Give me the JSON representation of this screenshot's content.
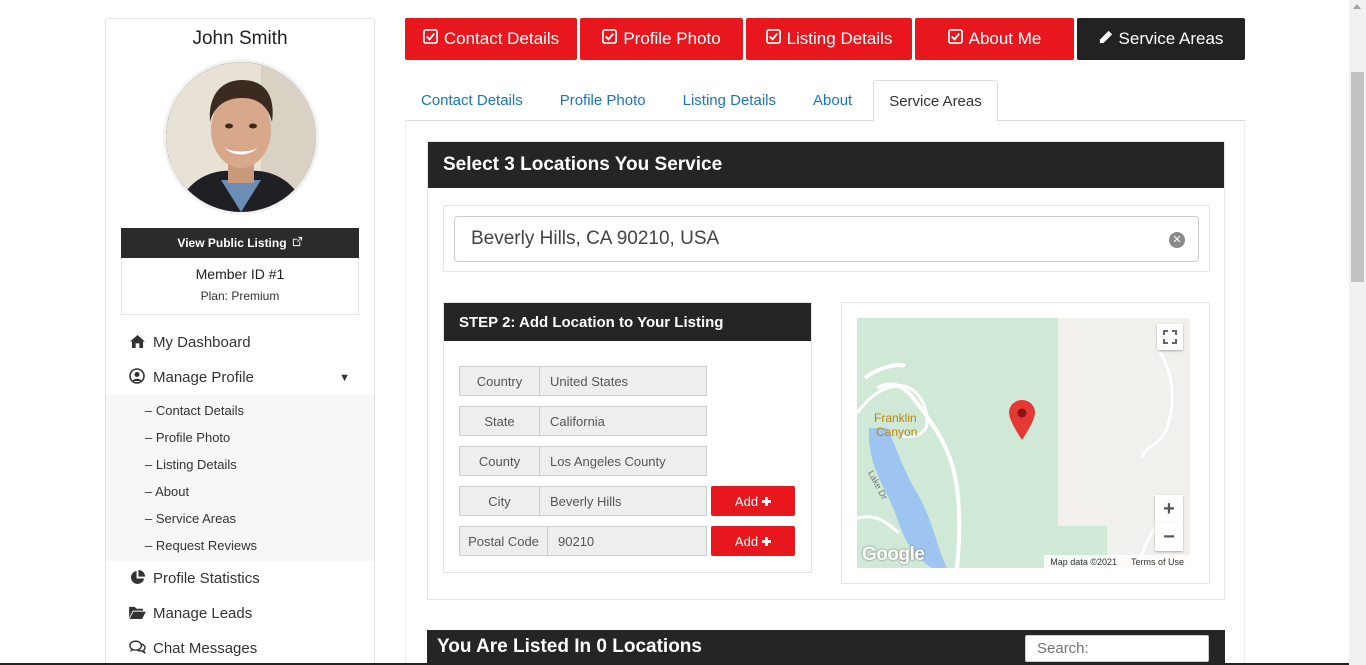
{
  "sidebar": {
    "user_name": "John Smith",
    "view_listing_label": "View Public Listing",
    "member_id": "Member ID #1",
    "plan": "Plan: Premium",
    "nav": {
      "dashboard": "My Dashboard",
      "manage_profile": "Manage Profile",
      "sub_items": [
        "– Contact Details",
        "– Profile Photo",
        "– Listing Details",
        "– About",
        "– Service Areas",
        "– Request Reviews"
      ],
      "statistics": "Profile Statistics",
      "leads": "Manage Leads",
      "chat": "Chat Messages"
    }
  },
  "top_buttons": {
    "contact": "Contact Details",
    "photo": "Profile Photo",
    "listing": "Listing Details",
    "about": "About Me",
    "service": "Service Areas"
  },
  "tabs": {
    "contact": "Contact Details",
    "photo": "Profile Photo",
    "listing": "Listing Details",
    "about": "About",
    "service": "Service Areas"
  },
  "locations_panel": {
    "title": "Select 3 Locations You Service",
    "search_value": "Beverly Hills, CA 90210, USA"
  },
  "step2": {
    "title": "STEP 2: Add Location to Your Listing",
    "fields": {
      "country_label": "Country",
      "country_value": "United States",
      "state_label": "State",
      "state_value": "California",
      "county_label": "County",
      "county_value": "Los Angeles County",
      "city_label": "City",
      "city_value": "Beverly Hills",
      "postal_label": "Postal Code",
      "postal_value": "90210"
    },
    "add_label": "Add"
  },
  "map": {
    "place_label_1": "Franklin",
    "place_label_2": "Canyon",
    "road_label": "Lake Dr",
    "logo": "Google",
    "attribution": "Map data ©2021",
    "terms": "Terms of Use",
    "zoom_in": "+",
    "zoom_out": "−",
    "fullscreen_icon": "fullscreen-icon",
    "marker_color": "#e53935"
  },
  "listed_panel": {
    "title": "You Are Listed In 0 Locations",
    "search_placeholder": "Search:"
  },
  "colors": {
    "accent": "#e8161d",
    "dark": "#222222",
    "link": "#1a73c9"
  }
}
